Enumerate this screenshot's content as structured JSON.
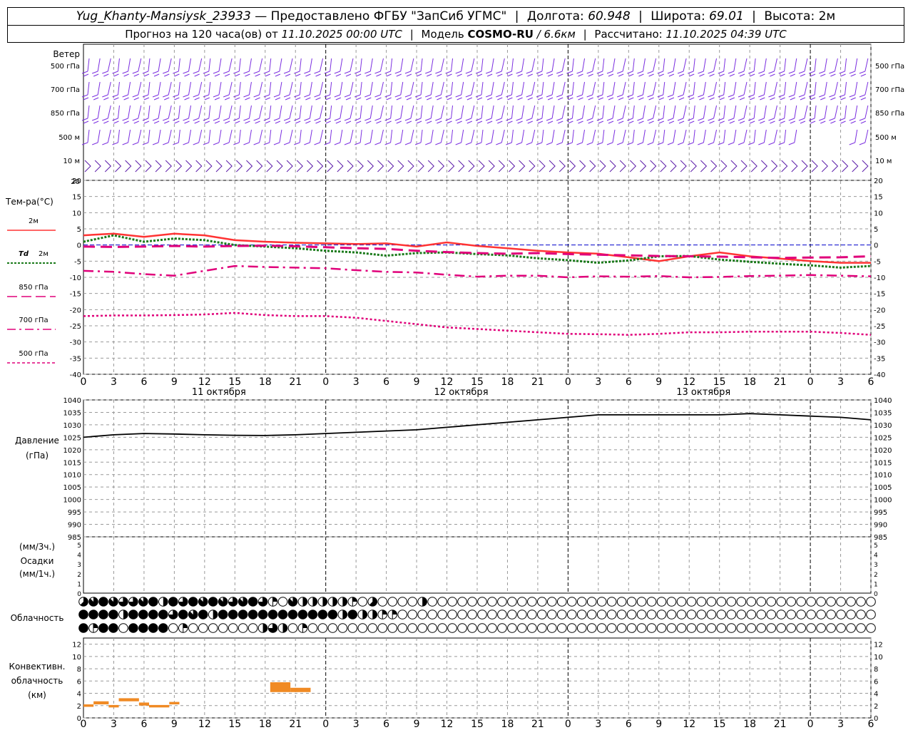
{
  "header": {
    "station": "Yug_Khanty-Mansiysk_23933",
    "provider": "— Предоставлено ФГБУ \"ЗапСиб УГМС\"",
    "lon_label": "Долгота:",
    "lon": "60.948",
    "lat_label": "Широта:",
    "lat": "69.01",
    "height_label": "Высота:",
    "height": "2м",
    "forecast_label": "Прогноз на 120 часа(ов) от",
    "forecast_start": "11.10.2025 00:00 UTC",
    "model_label": "Модель",
    "model": "COSMO-RU",
    "resolution": "/ 6.6км",
    "computed_label": "Рассчитано:",
    "computed": "11.10.2025 04:39 UTC"
  },
  "panels": {
    "wind": {
      "title": "Ветер",
      "levels": [
        "500 гПа",
        "700 гПа",
        "850 гПа",
        "500 м",
        "10 м"
      ]
    },
    "temperature": {
      "title": "Тем-ра(°С)",
      "legend": [
        {
          "label": "2м",
          "color": "#ff3333",
          "style": "solid"
        },
        {
          "label": "Td 2м",
          "color": "#1a7a1a",
          "style": "dotted"
        },
        {
          "label": "850 гПа",
          "color": "#e0007a",
          "style": "longdash"
        },
        {
          "label": "700 гПа",
          "color": "#e0007a",
          "style": "dashdot"
        },
        {
          "label": "500 гПа",
          "color": "#e0007a",
          "style": "dot"
        }
      ],
      "ticks": [
        "20",
        "15",
        "10",
        "5",
        "0",
        "-5",
        "-10",
        "-15",
        "-20",
        "-25",
        "-30",
        "-35",
        "-40"
      ]
    },
    "pressure": {
      "title": "Давление",
      "unit": "(гПа)",
      "ticks": [
        "1040",
        "1035",
        "1030",
        "1025",
        "1020",
        "1015",
        "1010",
        "1005",
        "1000",
        "995",
        "990",
        "985"
      ]
    },
    "precip": {
      "unit1": "(мм/3ч.)",
      "title": "Осадки",
      "unit2": "(мм/1ч.)",
      "ticks": [
        "5",
        "4",
        "3",
        "2",
        "1",
        "0"
      ]
    },
    "clouds": {
      "title": "Облачность"
    },
    "convective": {
      "title_line1": "Конвективн.",
      "title_line2": "облачность",
      "title_line3": "(км)",
      "ticks": [
        "12",
        "10",
        "8",
        "6",
        "4",
        "2",
        "0"
      ]
    }
  },
  "x_axis": {
    "hour_labels": [
      "0",
      "3",
      "6",
      "9",
      "12",
      "15",
      "18",
      "21",
      "0",
      "3",
      "6",
      "9",
      "12",
      "15",
      "18",
      "21",
      "0",
      "3",
      "6",
      "9",
      "12",
      "15",
      "18",
      "21",
      "0",
      "3",
      "6"
    ],
    "day_labels": [
      "11 октября",
      "12 октября",
      "13 октября"
    ]
  },
  "chart_data": [
    {
      "type": "line",
      "title": "Тем-ра(°С)",
      "x_unit": "hours from 11.10.2025 00:00 UTC",
      "x": [
        0,
        3,
        6,
        9,
        12,
        15,
        18,
        21,
        24,
        27,
        30,
        33,
        36,
        39,
        42,
        45,
        48,
        51,
        54,
        57,
        60,
        63,
        66,
        69,
        72,
        75,
        78
      ],
      "ylim": [
        -40,
        20
      ],
      "series": [
        {
          "name": "2м",
          "color": "#ff3333",
          "style": "solid",
          "values": [
            3,
            3.5,
            2.5,
            3.5,
            3,
            1.5,
            1,
            0.7,
            0.5,
            0.3,
            0.5,
            -0.5,
            0.8,
            -0.3,
            -1,
            -1.8,
            -2.3,
            -2.7,
            -3.8,
            -5,
            -3.5,
            -2.3,
            -3.5,
            -4.2,
            -5,
            -5.5,
            -5.5
          ]
        },
        {
          "name": "Td 2м",
          "color": "#1a7a1a",
          "style": "dotted",
          "values": [
            1,
            3,
            1,
            2,
            1.5,
            0,
            -0.5,
            -1,
            -1.8,
            -2.3,
            -3.3,
            -2.5,
            -2.3,
            -2.8,
            -3.2,
            -4.1,
            -4.7,
            -5.5,
            -4.8,
            -3.5,
            -3.4,
            -4.5,
            -5.2,
            -5.8,
            -6.3,
            -7,
            -6.5
          ]
        },
        {
          "name": "850 гПа",
          "color": "#e0007a",
          "style": "longdash",
          "values": [
            -0.5,
            -0.6,
            -0.5,
            -0.3,
            -0.5,
            -0.3,
            -0.2,
            -0.4,
            -0.7,
            -1,
            -1.2,
            -1.8,
            -2.2,
            -2.5,
            -2.7,
            -2.5,
            -2.8,
            -3,
            -3.2,
            -3.4,
            -3.5,
            -3.6,
            -3.8,
            -4,
            -3.9,
            -3.8,
            -3.5
          ]
        },
        {
          "name": "700 гПа",
          "color": "#e0007a",
          "style": "dashdot",
          "values": [
            -8,
            -8.3,
            -9,
            -9.5,
            -8,
            -6.5,
            -6.8,
            -7,
            -7.2,
            -7.8,
            -8.3,
            -8.5,
            -9.2,
            -9.8,
            -9.5,
            -9.5,
            -10,
            -9.7,
            -9.8,
            -9.6,
            -10,
            -9.9,
            -9.6,
            -9.5,
            -9.3,
            -9.5,
            -9.7
          ]
        },
        {
          "name": "500 гПа",
          "color": "#e0007a",
          "style": "dot",
          "values": [
            -22,
            -21.8,
            -21.8,
            -21.7,
            -21.5,
            -21,
            -21.7,
            -22,
            -22,
            -22.5,
            -23.5,
            -24.5,
            -25.5,
            -26,
            -26.5,
            -27,
            -27.5,
            -27.6,
            -27.8,
            -27.5,
            -27,
            -27,
            -26.8,
            -26.8,
            -26.8,
            -27.2,
            -27.8
          ]
        }
      ]
    },
    {
      "type": "line",
      "title": "Давление",
      "ylabel": "(гПа)",
      "x_unit": "hours from 11.10.2025 00:00 UTC",
      "x": [
        0,
        3,
        6,
        9,
        12,
        15,
        18,
        21,
        24,
        27,
        30,
        33,
        36,
        39,
        42,
        45,
        48,
        51,
        54,
        57,
        60,
        63,
        66,
        69,
        72,
        75,
        78
      ],
      "ylim": [
        985,
        1040
      ],
      "series": [
        {
          "name": "",
          "color": "#000000",
          "style": "solid",
          "values": [
            1025,
            1026,
            1026.5,
            1026.3,
            1026,
            1025.8,
            1025.7,
            1026,
            1026.5,
            1027,
            1027.5,
            1028,
            1029,
            1030,
            1031,
            1032,
            1033,
            1034,
            1034,
            1034,
            1034,
            1034,
            1034.5,
            1034,
            1033.5,
            1033,
            1032
          ]
        }
      ]
    },
    {
      "type": "bar",
      "title": "Конвективн. облачность",
      "ylabel": "(км)",
      "ylim": [
        0,
        13
      ],
      "note": "cloud layers from base to top, km",
      "x_start": [
        0,
        1,
        2.5,
        3.5,
        5.5,
        6.5,
        8.5,
        18.5,
        20.5
      ],
      "x_end": [
        1,
        2.5,
        3.5,
        5.5,
        6.5,
        8.5,
        9.5,
        20.5,
        22.5
      ],
      "base": [
        1.8,
        2.2,
        1.7,
        2.7,
        2,
        1.7,
        2.2,
        4.2,
        4.2
      ],
      "top": [
        2.2,
        2.7,
        2.1,
        3.2,
        2.5,
        2.1,
        2.6,
        5.8,
        4.9
      ]
    }
  ],
  "cloud_rows": {
    "note": "cloud cover in eighths per 1h step",
    "upper": [
      5,
      7,
      8,
      7,
      6,
      6,
      7,
      8,
      4,
      8,
      6,
      8,
      7,
      8,
      7,
      6,
      7,
      8,
      6,
      2,
      0,
      7,
      4,
      4,
      4,
      4,
      4,
      2,
      0,
      5,
      0,
      0,
      0,
      0,
      4,
      0,
      0,
      0,
      0,
      0,
      0,
      0,
      0,
      0,
      0,
      0,
      0,
      0,
      0,
      0,
      0,
      0,
      0,
      0,
      0,
      0,
      0,
      0,
      0,
      0,
      0,
      0,
      0,
      0,
      0,
      0,
      0,
      0,
      0,
      0,
      0,
      0,
      0,
      0,
      0,
      0,
      0,
      0,
      0,
      0
    ],
    "middle": [
      8,
      8,
      8,
      8,
      4,
      8,
      8,
      8,
      8,
      6,
      8,
      7,
      8,
      4,
      8,
      8,
      8,
      8,
      8,
      8,
      8,
      8,
      8,
      8,
      8,
      8,
      4,
      8,
      4,
      4,
      2,
      2,
      0,
      0,
      0,
      0,
      0,
      0,
      0,
      0,
      0,
      0,
      0,
      0,
      0,
      0,
      0,
      0,
      0,
      0,
      0,
      0,
      0,
      0,
      0,
      0,
      0,
      0,
      0,
      0,
      0,
      0,
      0,
      0,
      0,
      0,
      0,
      0,
      0,
      0,
      0,
      0,
      0,
      0,
      0,
      0,
      0,
      0,
      0,
      0
    ],
    "lower": [
      8,
      2,
      8,
      8,
      0,
      8,
      8,
      8,
      8,
      0,
      2,
      0,
      0,
      0,
      0,
      0,
      0,
      0,
      4,
      6,
      4,
      0,
      2,
      0,
      0,
      0,
      0,
      0,
      0,
      0,
      0,
      0,
      0,
      0,
      0,
      0,
      0,
      0,
      0,
      0,
      0,
      0,
      0,
      0,
      0,
      0,
      0,
      0,
      0,
      0,
      0,
      0,
      0,
      0,
      0,
      0,
      0,
      0,
      0,
      0,
      0,
      0,
      0,
      0,
      0,
      0,
      0,
      0,
      0,
      0,
      0,
      0,
      0,
      0,
      0,
      0,
      0,
      0,
      0,
      0
    ]
  }
}
